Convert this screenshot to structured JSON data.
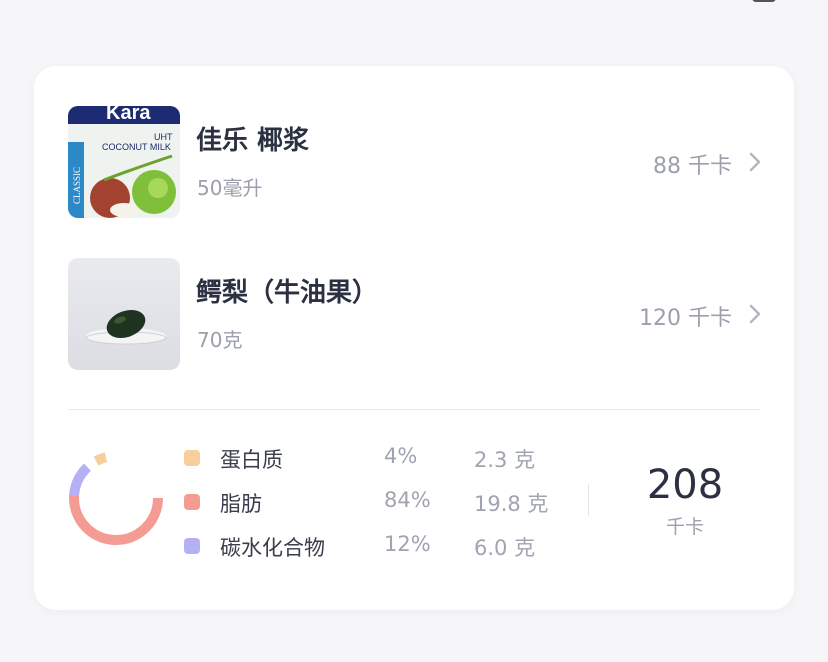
{
  "foods": [
    {
      "name": "佳乐 椰浆",
      "amount": "50毫升",
      "calories": "88 千卡",
      "image": "coconut-milk-photo"
    },
    {
      "name": "鳄梨（牛油果）",
      "amount": "70克",
      "calories": "120 千卡",
      "image": "avocado-photo"
    }
  ],
  "thumbnail_text": {
    "brand": "Kara",
    "uht": "UHT",
    "coconut_milk": "COCONUT MILK",
    "classic": "CLASSIC"
  },
  "macros": [
    {
      "name": "蛋白质",
      "percent": "4%",
      "grams": "2.3 克",
      "color": "#f8cf9a"
    },
    {
      "name": "脂肪",
      "percent": "84%",
      "grams": "19.8 克",
      "color": "#f49b93"
    },
    {
      "name": "碳水化合物",
      "percent": "12%",
      "grams": "6.0 克",
      "color": "#b3b0f5"
    }
  ],
  "total": {
    "value": "208",
    "unit": "千卡"
  },
  "chart_data": {
    "type": "pie",
    "categories": [
      "蛋白质",
      "脂肪",
      "碳水化合物"
    ],
    "values": [
      4,
      84,
      12
    ]
  }
}
